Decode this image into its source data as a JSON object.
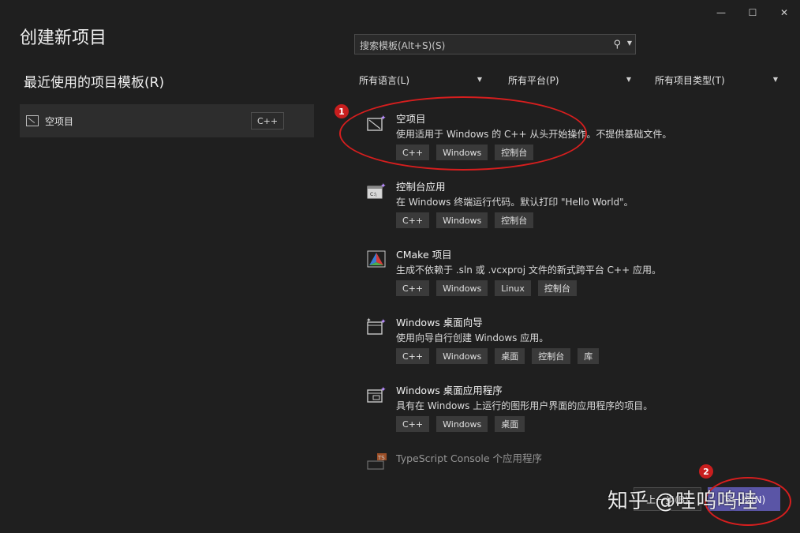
{
  "window": {
    "minimize_glyph": "—",
    "maximize_glyph": "☐",
    "close_glyph": "✕"
  },
  "page": {
    "title": "创建新项目"
  },
  "recent": {
    "heading": "最近使用的项目模板(R)",
    "items": [
      {
        "label": "空项目",
        "tag": "C++"
      }
    ]
  },
  "search": {
    "placeholder": "搜索模板(Alt+S)(S)"
  },
  "filters": {
    "language": "所有语言(L)",
    "platform": "所有平台(P)",
    "project_type": "所有项目类型(T)"
  },
  "templates": [
    {
      "name": "空项目",
      "icon": "empty-project-icon",
      "description": "使用适用于 Windows 的 C++ 从头开始操作。不提供基础文件。",
      "tags": [
        "C++",
        "Windows",
        "控制台"
      ]
    },
    {
      "name": "控制台应用",
      "icon": "console-app-icon",
      "description": "在 Windows 终端运行代码。默认打印 \"Hello World\"。",
      "tags": [
        "C++",
        "Windows",
        "控制台"
      ]
    },
    {
      "name": "CMake 项目",
      "icon": "cmake-icon",
      "description": "生成不依赖于 .sln 或 .vcxproj 文件的新式跨平台 C++ 应用。",
      "tags": [
        "C++",
        "Windows",
        "Linux",
        "控制台"
      ]
    },
    {
      "name": "Windows 桌面向导",
      "icon": "desktop-wizard-icon",
      "description": "使用向导自行创建 Windows 应用。",
      "tags": [
        "C++",
        "Windows",
        "桌面",
        "控制台",
        "库"
      ]
    },
    {
      "name": "Windows 桌面应用程序",
      "icon": "desktop-app-icon",
      "description": "具有在 Windows 上运行的图形用户界面的应用程序的项目。",
      "tags": [
        "C++",
        "Windows",
        "桌面"
      ]
    },
    {
      "name": "TypeScript Console 个应用程序",
      "icon": "typescript-icon"
    }
  ],
  "footer": {
    "back_label": "上一步(B)",
    "next_label": "下一步(N)"
  },
  "annotations": {
    "callout_1": "1",
    "callout_2": "2",
    "watermark": "知乎 @哇呜呜哇"
  },
  "colors": {
    "accent": "#5a55a6",
    "annotation_red": "#d61e1e"
  }
}
